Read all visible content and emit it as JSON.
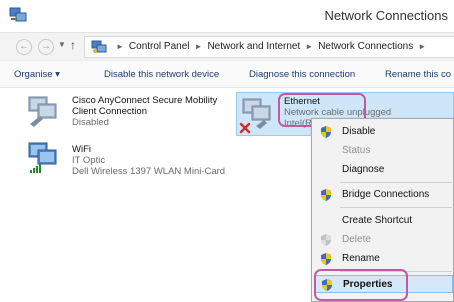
{
  "window": {
    "title": "Network Connections"
  },
  "navigation": {
    "back_glyph": "←",
    "forward_glyph": "→",
    "dropdown_glyph": "▼",
    "up_glyph": "↑",
    "breadcrumbs": [
      "Control Panel",
      "Network and Internet",
      "Network Connections"
    ],
    "separator": "►"
  },
  "toolbar": {
    "organise": "Organise ▾",
    "disable": "Disable this network device",
    "diagnose": "Diagnose this connection",
    "rename": "Rename this co"
  },
  "connections": [
    {
      "name_line1": "Cisco AnyConnect Secure Mobility",
      "name_line2": "Client Connection",
      "status": "Disabled",
      "device": ""
    },
    {
      "name": "WiFi",
      "status": "IT Optic",
      "device": "Dell Wireless 1397 WLAN Mini-Card"
    },
    {
      "name": "Ethernet",
      "status": "Network cable unplugged",
      "device": "Intel(R"
    }
  ],
  "context_menu": {
    "items": [
      {
        "label": "Disable",
        "shield": true,
        "disabled": false,
        "bold": false
      },
      {
        "label": "Status",
        "shield": false,
        "disabled": true,
        "bold": false
      },
      {
        "label": "Diagnose",
        "shield": false,
        "disabled": false,
        "bold": false
      },
      {
        "label": "Bridge Connections",
        "shield": true,
        "disabled": false,
        "bold": false
      },
      {
        "label": "Create Shortcut",
        "shield": false,
        "disabled": false,
        "bold": false
      },
      {
        "label": "Delete",
        "shield": true,
        "disabled": true,
        "bold": false
      },
      {
        "label": "Rename",
        "shield": true,
        "disabled": false,
        "bold": false
      },
      {
        "label": "Properties",
        "shield": true,
        "disabled": false,
        "bold": true
      }
    ]
  },
  "colors": {
    "highlight": "#cfe6f9",
    "annotation": "#c05ba0",
    "link": "#1c3c6e",
    "error": "#d62b20"
  }
}
